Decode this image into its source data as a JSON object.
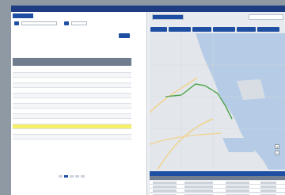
{
  "header": {
    "title": "",
    "nav": [
      "",
      "",
      "",
      ""
    ]
  },
  "left_panel": {
    "tab_label": "",
    "form": {
      "chip_1": "",
      "field_1": "",
      "chip_2": "",
      "field_2": "",
      "search_label": ""
    },
    "table": {
      "columns": [
        "",
        "",
        "",
        ""
      ],
      "rows": [
        {
          "id": "",
          "name": "",
          "a": "",
          "b": "",
          "highlight": false
        },
        {
          "id": "",
          "name": "",
          "a": "",
          "b": "",
          "highlight": false
        },
        {
          "id": "",
          "name": "",
          "a": "",
          "b": "",
          "highlight": false
        },
        {
          "id": "",
          "name": "",
          "a": "",
          "b": "",
          "highlight": false
        },
        {
          "id": "",
          "name": "",
          "a": "",
          "b": "",
          "highlight": false
        },
        {
          "id": "",
          "name": "",
          "a": "",
          "b": "",
          "highlight": false
        },
        {
          "id": "",
          "name": "",
          "a": "",
          "b": "",
          "highlight": false
        },
        {
          "id": "",
          "name": "",
          "a": "",
          "b": "",
          "highlight": false
        },
        {
          "id": "",
          "name": "",
          "a": "",
          "b": "",
          "highlight": false
        },
        {
          "id": "",
          "name": "",
          "a": "",
          "b": "",
          "highlight": false
        },
        {
          "id": "",
          "name": "",
          "a": "",
          "b": "",
          "highlight": false
        },
        {
          "id": "",
          "name": "",
          "a": "",
          "b": "",
          "highlight": true
        },
        {
          "id": "",
          "name": "",
          "a": "",
          "b": "",
          "highlight": false
        },
        {
          "id": "",
          "name": "",
          "a": "",
          "b": "",
          "highlight": false
        }
      ]
    },
    "pager": [
      "",
      "",
      "",
      "",
      ""
    ]
  },
  "right_panel": {
    "tabs": [
      "",
      ""
    ],
    "subtabs": [
      "",
      "",
      ""
    ],
    "buttons": [
      "",
      "",
      "",
      "",
      "",
      ""
    ],
    "map": {
      "zoom_in": "+",
      "zoom_out": "−",
      "colors": {
        "water": "#b6cce6",
        "land": "#e3e6ea",
        "route": "#49a34b",
        "road": "#f2d28c"
      }
    },
    "results": {
      "title": "",
      "columns": [
        "",
        "",
        "",
        ""
      ],
      "rows": 5
    }
  },
  "colors": {
    "brand": "#1d3c82",
    "accent": "#1f4fa3",
    "highlight": "#f6ef6a",
    "table_header": "#6f7d8f"
  }
}
